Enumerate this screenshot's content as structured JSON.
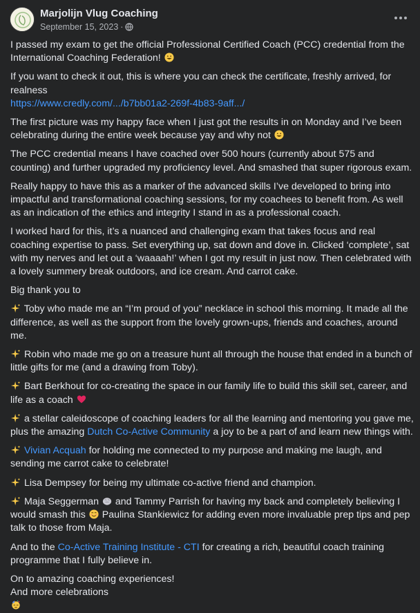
{
  "post": {
    "author": "Marjolijn Vlug Coaching",
    "date": "September 15, 2023",
    "separator": "·",
    "visibility_icon": "globe-icon",
    "more_icon": "more-horizontal-icon"
  },
  "body": {
    "p1": "I passed my exam to get the official Professional Certified Coach (PCC) credential from the International Coaching Federation!",
    "p2_text": "If you want to check it out, this is where you can check the certificate, freshly arrived, for realness",
    "p2_link": "https://www.credly.com/.../b7bb01a2-269f-4b83-9aff.../",
    "p3": "The first picture was my happy face when I just got the results in on Monday and I’ve been celebrating during the entire week because yay and why not",
    "p4": "The PCC credential means I have coached over 500 hours (currently about 575 and counting) and further upgraded my proficiency level. And smashed that super rigorous exam.",
    "p5": "Really happy to have this as a marker of the advanced skills I’ve developed to bring into impactful and transformational coaching sessions, for my coachees to benefit from. As well as an indication of the ethics and integrity I stand in as a professional coach.",
    "p6": "I worked hard for this, it’s a nuanced and challenging exam that takes focus and real coaching expertise to pass. Set everything up, sat down and dove in. Clicked ‘complete’, sat with my nerves and let out a ‘waaaah!’ when I got my result in just now. Then celebrated with a lovely summery break outdoors, and ice cream. And carrot cake.",
    "p7": "Big thank you to",
    "p8": "Toby who made me an “I’m proud of you” necklace in school this morning. It made all the difference, as well as the support from the lovely grown-ups, friends and coaches, around me.",
    "p9": "Robin who made me go on a treasure hunt all through the house that ended in a bunch of little gifts for me (and a drawing from Toby).",
    "p10": "Bart Berkhout for co-creating the space in our family life to build this skill set, career, and life as a coach",
    "p11_a": "a stellar caleidoscope of coaching leaders for all the learning and mentoring you gave me, plus the amazing",
    "p11_link": "Dutch Co-Active Community",
    "p11_b": "a joy to be a part of and learn new things with.",
    "p12_link": "Vivian Acquah",
    "p12_b": "for holding me connected to my purpose and making me laugh, and sending me carrot cake to celebrate!",
    "p13": "Lisa Dempsey for being my ultimate co-active friend and champion.",
    "p14_a": "Maja Seggerman",
    "p14_b": "and Tammy Parrish for having my back and completely believing I would smash this",
    "p14_c": "Paulina Stankiewicz for adding even more invaluable prep tips and pep talk to those from Maja.",
    "p15_a": "And to the",
    "p15_link": "Co-Active Training Institute - CTI",
    "p15_b": "for creating a rich, beautiful coach training programme that I fully believe in.",
    "p16": "On to amazing coaching experiences!",
    "p17": "And more celebrations"
  },
  "emojis": {
    "smile": "grinning-face-emoji",
    "sparkles": "sparkles-emoji",
    "heart": "red-heart-emoji",
    "brain": "brain-emoji",
    "blush": "smiling-face-emoji",
    "party": "partying-face-emoji"
  },
  "colors": {
    "background": "#242526",
    "text": "#e4e6eb",
    "secondary_text": "#b0b3b8",
    "link": "#4599ff"
  }
}
